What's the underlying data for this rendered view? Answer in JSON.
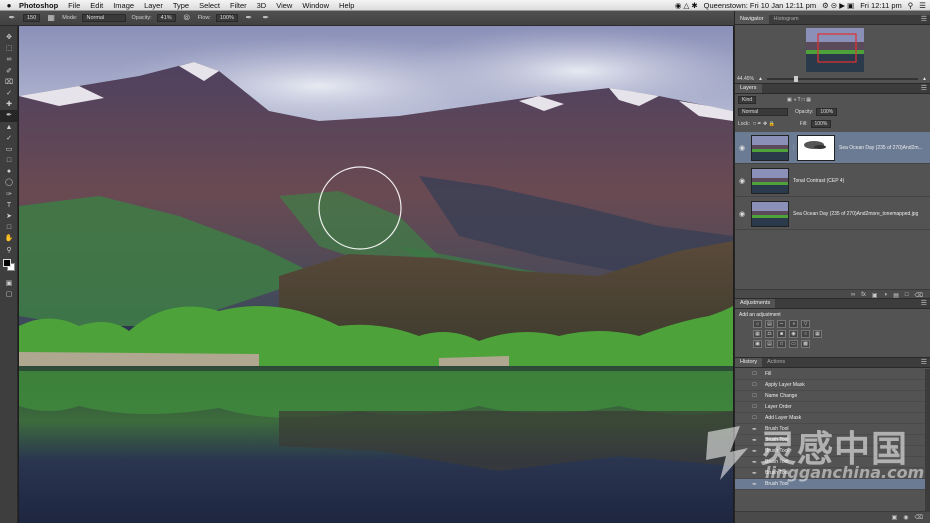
{
  "menubar": {
    "app": "Photoshop",
    "menus": [
      "File",
      "Edit",
      "Image",
      "Layer",
      "Type",
      "Select",
      "Filter",
      "3D",
      "View",
      "Window",
      "Help"
    ],
    "clock_location": "Queenstown: Fri 10 Jan  12:11 pm",
    "clock_local": "Fri 12:11 pm"
  },
  "options": {
    "brush_size": "150",
    "mode_label": "Mode:",
    "mode_value": "Normal",
    "opacity_label": "Opacity:",
    "opacity_value": "41%",
    "flow_label": "Flow:",
    "flow_value": "100%"
  },
  "tools": {
    "items": [
      "move-tool",
      "marquee-tool",
      "lasso-tool",
      "quick-select-tool",
      "crop-tool",
      "eyedropper-tool",
      "healing-tool",
      "brush-tool",
      "stamp-tool",
      "history-brush-tool",
      "eraser-tool",
      "gradient-tool",
      "blur-tool",
      "dodge-tool",
      "pen-tool",
      "type-tool",
      "path-select-tool",
      "shape-tool",
      "hand-tool",
      "zoom-tool"
    ],
    "active_index": 7,
    "foreground_color": "#000000",
    "background_color": "#ffffff"
  },
  "navigator": {
    "tabs": [
      "Navigator",
      "Histogram"
    ],
    "zoom": "44.45%"
  },
  "layers": {
    "tabs": [
      "Layers"
    ],
    "kind_label": "Kind",
    "blend_mode": "Normal",
    "opacity_label": "Opacity:",
    "opacity_value": "100%",
    "lock_label": "Lock:",
    "fill_label": "Fill:",
    "fill_value": "100%",
    "items": [
      {
        "name": "Sea Ocean Day (235 of 270)And2m...",
        "selected": true,
        "has_mask": true
      },
      {
        "name": "Tonal Contrast (CEP 4)",
        "selected": false,
        "has_mask": false
      },
      {
        "name": "Sea Ocean Day (235 of 270)And2more_tonemapped.jpg",
        "selected": false,
        "has_mask": false
      }
    ]
  },
  "adjustments": {
    "tab": "Adjustments",
    "add_label": "Add an adjustment"
  },
  "history": {
    "tabs": [
      "History",
      "Actions"
    ],
    "items": [
      "Fill",
      "Apply Layer Mask",
      "Name Change",
      "Layer Order",
      "Add Layer Mask",
      "Brush Tool",
      "Brush Tool",
      "Brush Tool",
      "Brush Tool",
      "Brush Tool",
      "Brush Tool"
    ],
    "selected_index": 10
  },
  "watermark": {
    "cn": "灵感中国",
    "en": "lingganchina.com"
  }
}
